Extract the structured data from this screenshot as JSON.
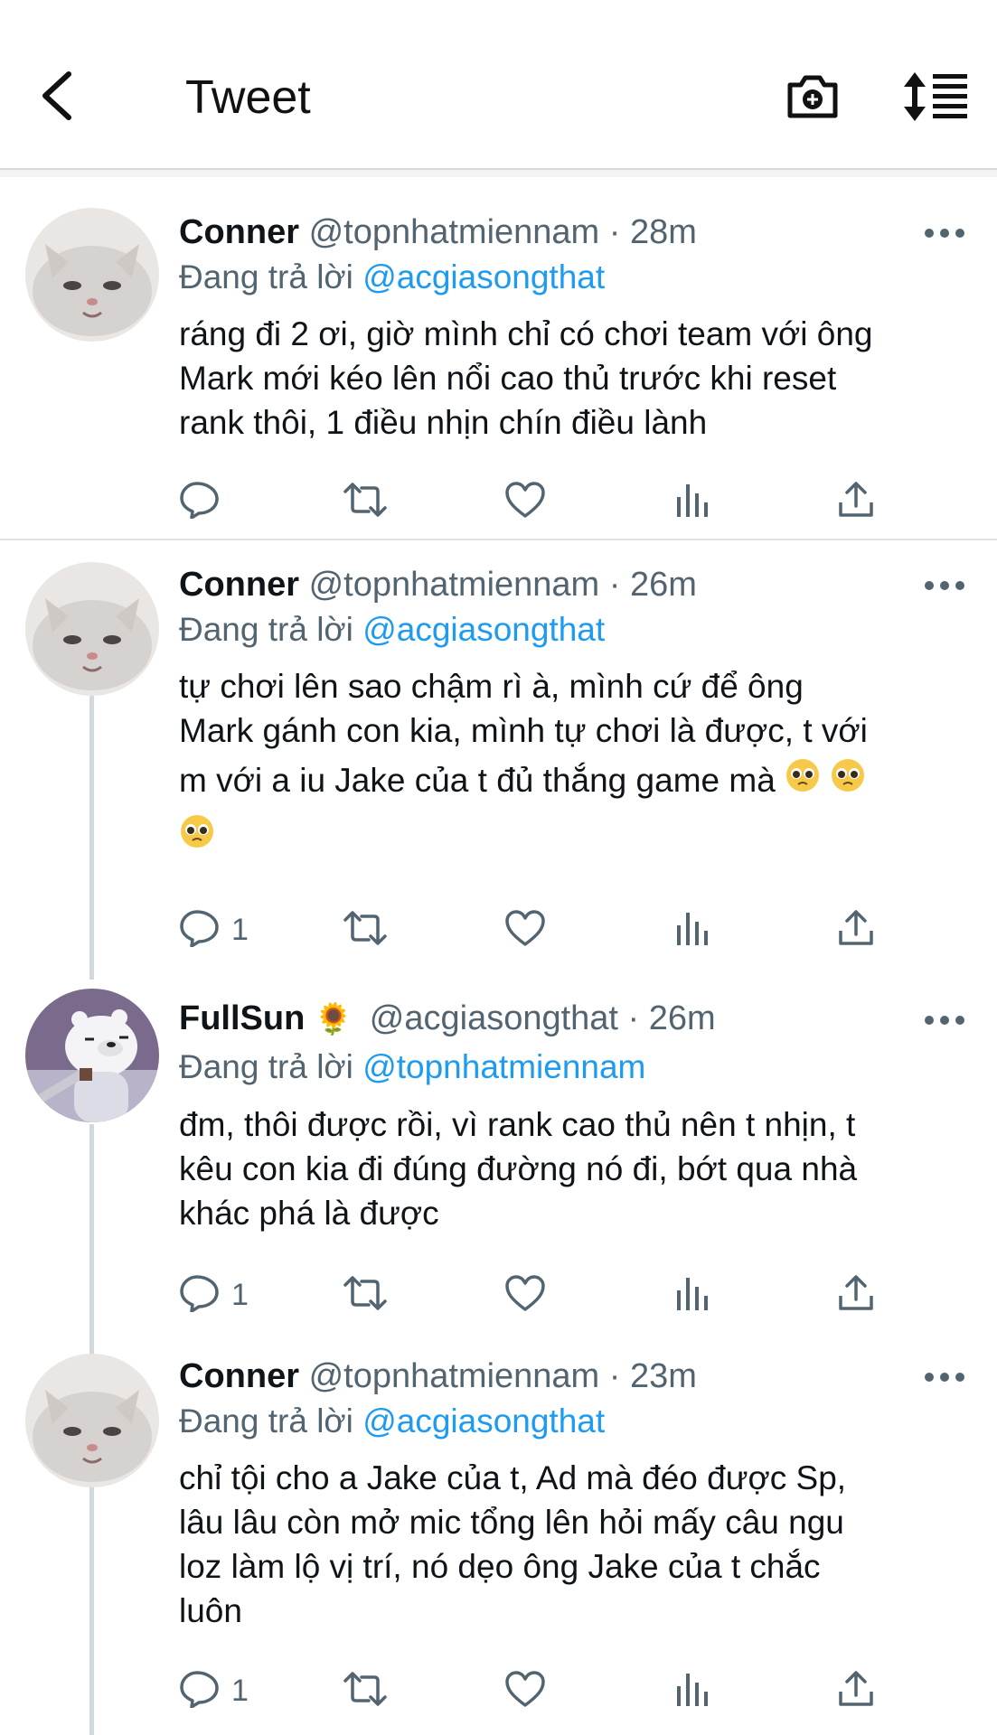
{
  "header": {
    "title": "Tweet",
    "back_icon": "back-arrow-icon",
    "camera_icon": "camera-plus-icon",
    "sort_icon": "sort-icon"
  },
  "colors": {
    "link": "#1d9bf0",
    "muted": "#536471",
    "text": "#0f1419"
  },
  "tweets": [
    {
      "name": "Conner",
      "emoji": "",
      "handle_time": "@topnhatmiennam · 28m",
      "reply_prefix": "Đang trả lời",
      "reply_to": "@acgiasongthat",
      "lines": [
        "ráng đi 2 ơi, giờ mình chỉ có chơi team với ông",
        "Mark mới kéo lên nổi cao thủ trước khi reset",
        "rank thôi, 1 điều nhịn chín điều lành"
      ],
      "reply_count": ""
    },
    {
      "name": "Conner",
      "emoji": "",
      "handle_time": "@topnhatmiennam · 26m",
      "reply_prefix": "Đang trả lời",
      "reply_to": "@acgiasongthat",
      "lines": [
        "tự chơi lên sao chậm rì à, mình cứ để ông",
        "Mark gánh con kia, mình tự chơi là được, t với",
        "m với a iu Jake của t đủ thắng game mà"
      ],
      "emojis": "🥺🥺🥺",
      "reply_count": "1"
    },
    {
      "name": "FullSun",
      "emoji": "🌻",
      "handle_time": "@acgiasongthat · 26m",
      "reply_prefix": "Đang trả lời",
      "reply_to": "@topnhatmiennam",
      "lines": [
        "đm, thôi được rồi, vì rank cao thủ nên t nhịn, t",
        "kêu con kia đi đúng đường nó đi, bớt qua nhà",
        "khác phá là được"
      ],
      "reply_count": "1"
    },
    {
      "name": "Conner",
      "emoji": "",
      "handle_time": "@topnhatmiennam · 23m",
      "reply_prefix": "Đang trả lời",
      "reply_to": "@acgiasongthat",
      "lines": [
        "chỉ tội cho a Jake của t, Ad mà đéo được Sp,",
        "lâu lâu còn mở mic tổng lên hỏi mấy câu ngu",
        "loz làm lộ vị trí, nó dẹo ông Jake của t chắc",
        "luôn"
      ],
      "reply_count": "1"
    }
  ]
}
